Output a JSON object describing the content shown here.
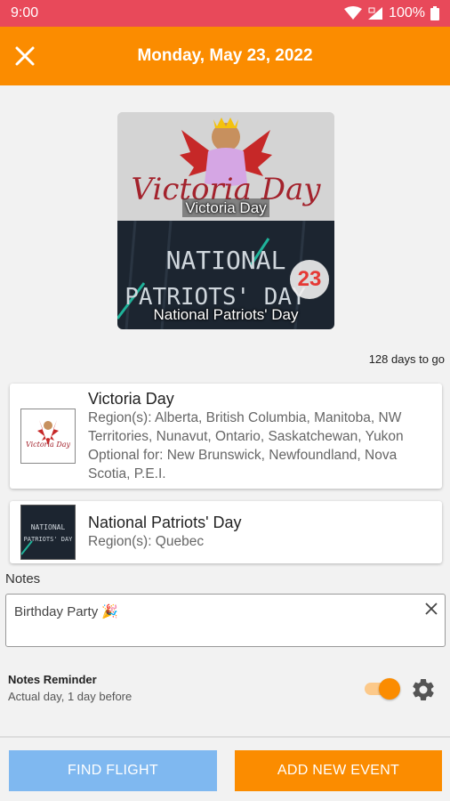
{
  "status_bar": {
    "time": "9:00",
    "battery": "100%"
  },
  "app_bar": {
    "title": "Monday, May 23, 2022"
  },
  "hero": {
    "label_1": "Victoria Day",
    "label_2": "National Patriots' Day",
    "art_top_text": "Victoria Day",
    "art_bottom_line1": "NATIONAL",
    "art_bottom_line2": "PATRIOTS' DAY",
    "day_badge": "23"
  },
  "days_to_go": "128 days to go",
  "events": [
    {
      "title": "Victoria Day",
      "regions": "Region(s): Alberta, British Columbia, Manitoba, NW Territories, Nunavut, Ontario, Saskatchewan, Yukon",
      "optional": "Optional for: New Brunswick, Newfoundland, Nova Scotia, P.E.I."
    },
    {
      "title": "National Patriots' Day",
      "regions": "Region(s): Quebec"
    }
  ],
  "notes": {
    "label": "Notes",
    "value": "Birthday Party 🎉",
    "clear_icon": "close-icon"
  },
  "reminder": {
    "title": "Notes Reminder",
    "subtitle": "Actual day, 1 day before",
    "enabled": true
  },
  "buttons": {
    "find_flight": "FIND FLIGHT",
    "add_event": "ADD NEW EVENT"
  },
  "colors": {
    "status_bar": "#e8495a",
    "accent": "#fb8c00",
    "find_flight": "#7fb8f0",
    "badge_text": "#e53935"
  }
}
